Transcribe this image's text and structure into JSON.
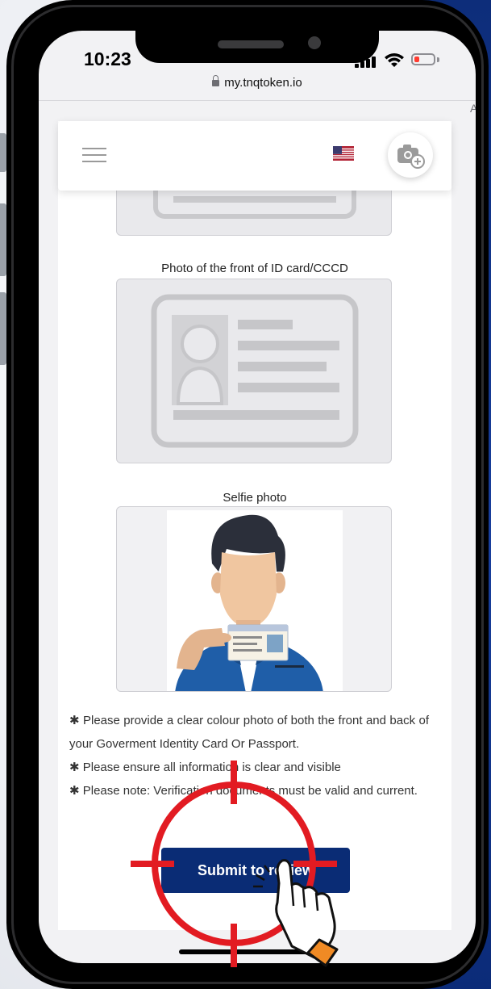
{
  "status_bar": {
    "time": "10:23"
  },
  "browser": {
    "url": "my.tnqtoken.io",
    "text_size_button": "AA"
  },
  "labels": {
    "front_id": "Photo of the front of ID card/CCCD",
    "selfie": "Selfie photo"
  },
  "notes": [
    "✱ Please provide a clear colour photo of both the front and back of your Goverment Identity Card Or Passport.",
    "✱ Please ensure all information is clear and visible",
    "✱ Please note: Verification documents must be valid and current."
  ],
  "submit_label": "Submit to review",
  "colors": {
    "brand": "#0a2c75",
    "target": "#e21b22",
    "background_blue": "#183e9c"
  },
  "icons": {
    "menu": "hamburger-icon",
    "language": "us-flag-icon",
    "upload": "camera-plus-icon",
    "secure": "lock-icon",
    "tap": "hand-pointer-icon",
    "target": "crosshair-icon"
  }
}
